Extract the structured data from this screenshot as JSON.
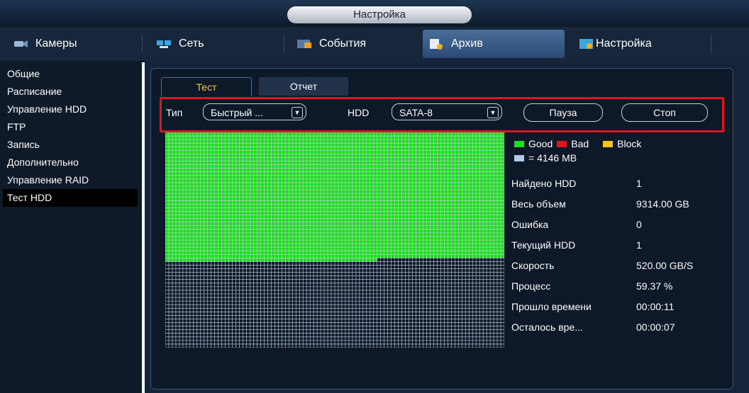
{
  "window": {
    "title": "Настройка"
  },
  "tabs": [
    {
      "label": "Камеры",
      "icon": "camera-icon"
    },
    {
      "label": "Сеть",
      "icon": "network-icon"
    },
    {
      "label": "События",
      "icon": "events-icon"
    },
    {
      "label": "Архив",
      "icon": "archive-icon",
      "active": true
    },
    {
      "label": "Настройка",
      "icon": "settings-icon"
    }
  ],
  "sidebar": {
    "items": [
      {
        "label": "Общие"
      },
      {
        "label": "Расписание"
      },
      {
        "label": "Управление HDD"
      },
      {
        "label": "FTP"
      },
      {
        "label": "Запись"
      },
      {
        "label": "Дополнительно"
      },
      {
        "label": "Управление RAID"
      },
      {
        "label": "Тест HDD",
        "active": true
      }
    ]
  },
  "subtabs": {
    "test": "Тест",
    "report": "Отчет"
  },
  "controls": {
    "type_label": "Тип",
    "type_value": "Быстрый ...",
    "hdd_label": "HDD",
    "hdd_value": "SATA-8",
    "pause_label": "Пауза",
    "stop_label": "Стоп"
  },
  "legend": {
    "good": "Good",
    "bad": "Bad",
    "block": "Block",
    "unit": "= 4146 MB",
    "colors": {
      "good": "#1fdc1f",
      "bad": "#e0141e",
      "block": "#f5c518",
      "unit": "#b4c8e8"
    }
  },
  "stats": [
    {
      "label": "Найдено HDD",
      "value": "1"
    },
    {
      "label": "Весь объем",
      "value": "9314.00 GB"
    },
    {
      "label": "Ошибка",
      "value": "0"
    },
    {
      "label": "Текущий HDD",
      "value": "1"
    },
    {
      "label": "Скорость",
      "value": "520.00 GB/S"
    },
    {
      "label": "Процесс",
      "value": "59.37 %"
    },
    {
      "label": "Прошло времени",
      "value": "00:00:11"
    },
    {
      "label": "Осталось вре...",
      "value": "00:00:07"
    }
  ],
  "test_grid": {
    "progress_percent": 59.37,
    "columns": 96,
    "rows": 60
  }
}
